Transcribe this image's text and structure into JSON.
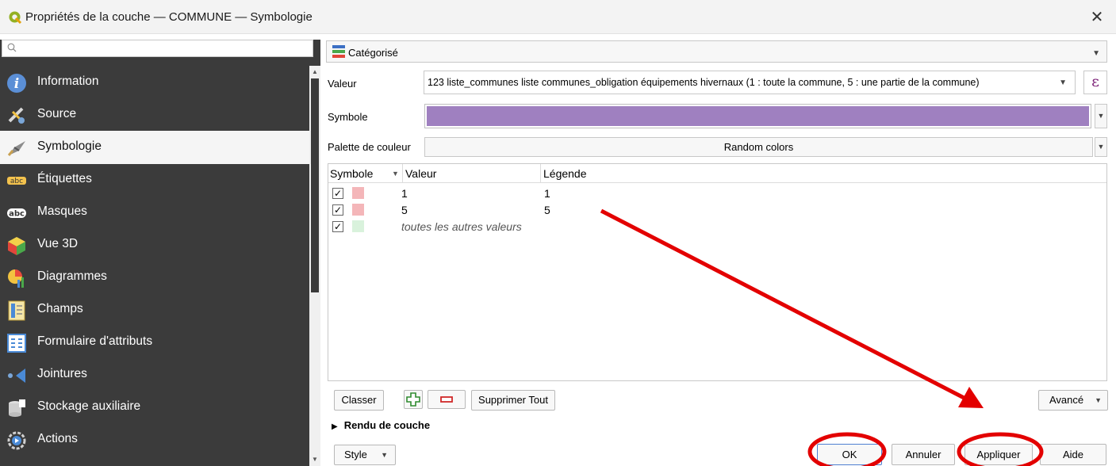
{
  "window": {
    "title": "Propriétés de la couche — COMMUNE — Symbologie",
    "close_glyph": "✕"
  },
  "sidebar": {
    "search_placeholder": "",
    "items": [
      {
        "label": "Information",
        "icon": "info-icon"
      },
      {
        "label": "Source",
        "icon": "source-icon"
      },
      {
        "label": "Symbologie",
        "icon": "symbology-icon",
        "selected": true
      },
      {
        "label": "Étiquettes",
        "icon": "labels-icon"
      },
      {
        "label": "Masques",
        "icon": "masks-icon"
      },
      {
        "label": "Vue 3D",
        "icon": "3d-view-icon"
      },
      {
        "label": "Diagrammes",
        "icon": "diagrams-icon"
      },
      {
        "label": "Champs",
        "icon": "fields-icon"
      },
      {
        "label": "Formulaire d'attributs",
        "icon": "attribute-form-icon"
      },
      {
        "label": "Jointures",
        "icon": "joins-icon"
      },
      {
        "label": "Stockage auxiliaire",
        "icon": "auxiliary-storage-icon"
      },
      {
        "label": "Actions",
        "icon": "actions-icon"
      }
    ]
  },
  "renderer": {
    "type_label": "Catégorisé"
  },
  "form": {
    "valeur_label": "Valeur",
    "valeur_value": "123 liste_communes liste communes_obligation équipements hivernaux (1 : toute la commune, 5 : une partie de la commune)",
    "epsilon_glyph": "ε",
    "symbole_label": "Symbole",
    "symbol_color": "#9f80c0",
    "palette_label": "Palette de couleur",
    "palette_value": "Random colors"
  },
  "table": {
    "headers": {
      "symbole": "Symbole",
      "valeur": "Valeur",
      "legende": "Légende"
    },
    "rows": [
      {
        "checked": "✓",
        "color": "#f4b6b9",
        "value": "1",
        "legend": "1"
      },
      {
        "checked": "✓",
        "color": "#f4b6b9",
        "value": "5",
        "legend": "5"
      },
      {
        "checked": "✓",
        "color": "#d9f2dc",
        "other": "toutes les autres valeurs"
      }
    ]
  },
  "buttons": {
    "classer": "Classer",
    "supprimer_tout": "Supprimer Tout",
    "avance": "Avancé",
    "rendu_de_couche": "Rendu de couche",
    "style": "Style",
    "ok": "OK",
    "annuler": "Annuler",
    "appliquer": "Appliquer",
    "aide": "Aide"
  },
  "annotation": {
    "color": "#e30000"
  }
}
